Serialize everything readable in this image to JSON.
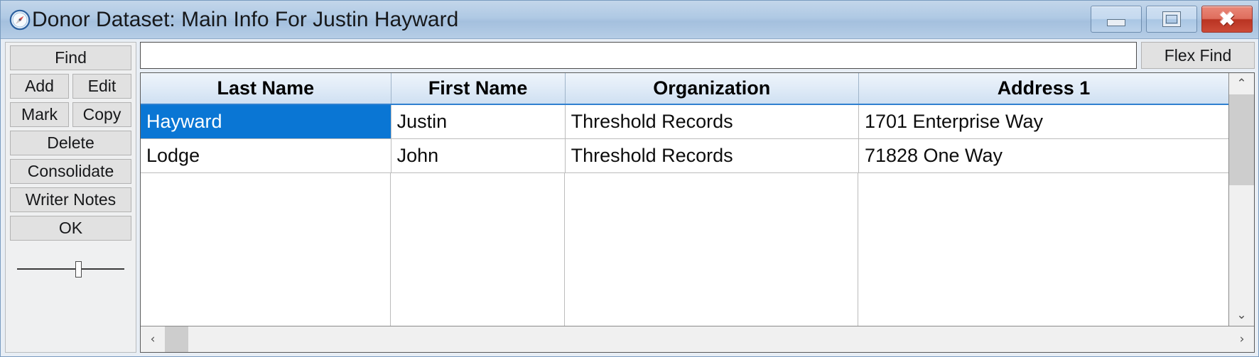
{
  "window": {
    "title": "Donor Dataset: Main Info For Justin Hayward",
    "icon": "compass-icon",
    "controls": {
      "minimize": "minimize-icon",
      "maximize": "maximize-icon",
      "close": "✖"
    },
    "accent_color": "#0a76d4",
    "titlebar_color": "#a8c3e0",
    "close_button_color": "#c03a26"
  },
  "sidebar": {
    "buttons": [
      {
        "label": "Find",
        "name": "find-button"
      },
      {
        "label": "Add",
        "name": "add-button"
      },
      {
        "label": "Edit",
        "name": "edit-button"
      },
      {
        "label": "Mark",
        "name": "mark-button"
      },
      {
        "label": "Copy",
        "name": "copy-button"
      },
      {
        "label": "Delete",
        "name": "delete-button"
      },
      {
        "label": "Consolidate",
        "name": "consolidate-button"
      },
      {
        "label": "Writer Notes",
        "name": "writer-notes-button"
      },
      {
        "label": "OK",
        "name": "ok-button"
      }
    ],
    "slider": {
      "name": "size-slider",
      "position_percent": 57
    }
  },
  "findbar": {
    "search_value": "",
    "search_placeholder": "",
    "flex_find_label": "Flex Find"
  },
  "grid": {
    "columns": [
      "Last Name",
      "First Name",
      "Organization",
      "Address 1"
    ],
    "rows": [
      {
        "last_name": "Hayward",
        "first_name": "Justin",
        "organization": "Threshold Records",
        "address_1": "1701 Enterprise Way",
        "selected_cell": "last_name"
      },
      {
        "last_name": "Lodge",
        "first_name": "John",
        "organization": "Threshold Records",
        "address_1": "71828 One Way",
        "selected_cell": ""
      }
    ],
    "scroll": {
      "vertical_up": "⌃",
      "vertical_down": "⌄",
      "horizontal_left": "‹",
      "horizontal_right": "›"
    }
  }
}
